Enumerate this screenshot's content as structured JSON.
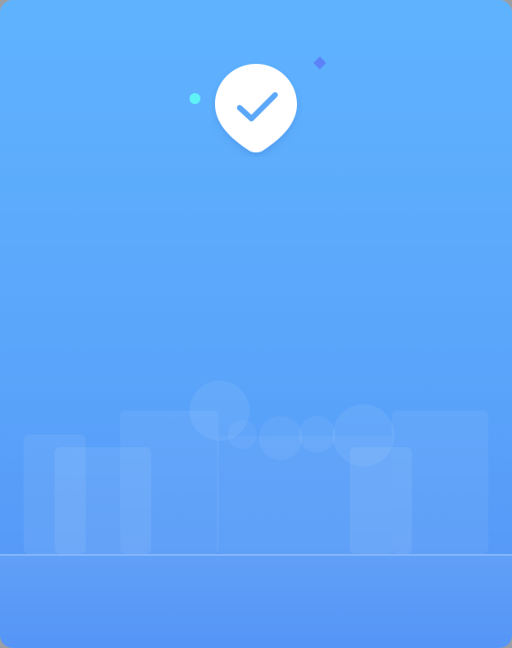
{
  "scene": {
    "icon": "verified-checkmark-pin-icon",
    "accent_colors": {
      "background_top": "#5fb3fe",
      "background_bottom": "#5595f6",
      "pin": "#ffffff",
      "check": "#5ba8f9",
      "dot": "#5ff2f6",
      "diamond": "#5b83f7"
    }
  }
}
